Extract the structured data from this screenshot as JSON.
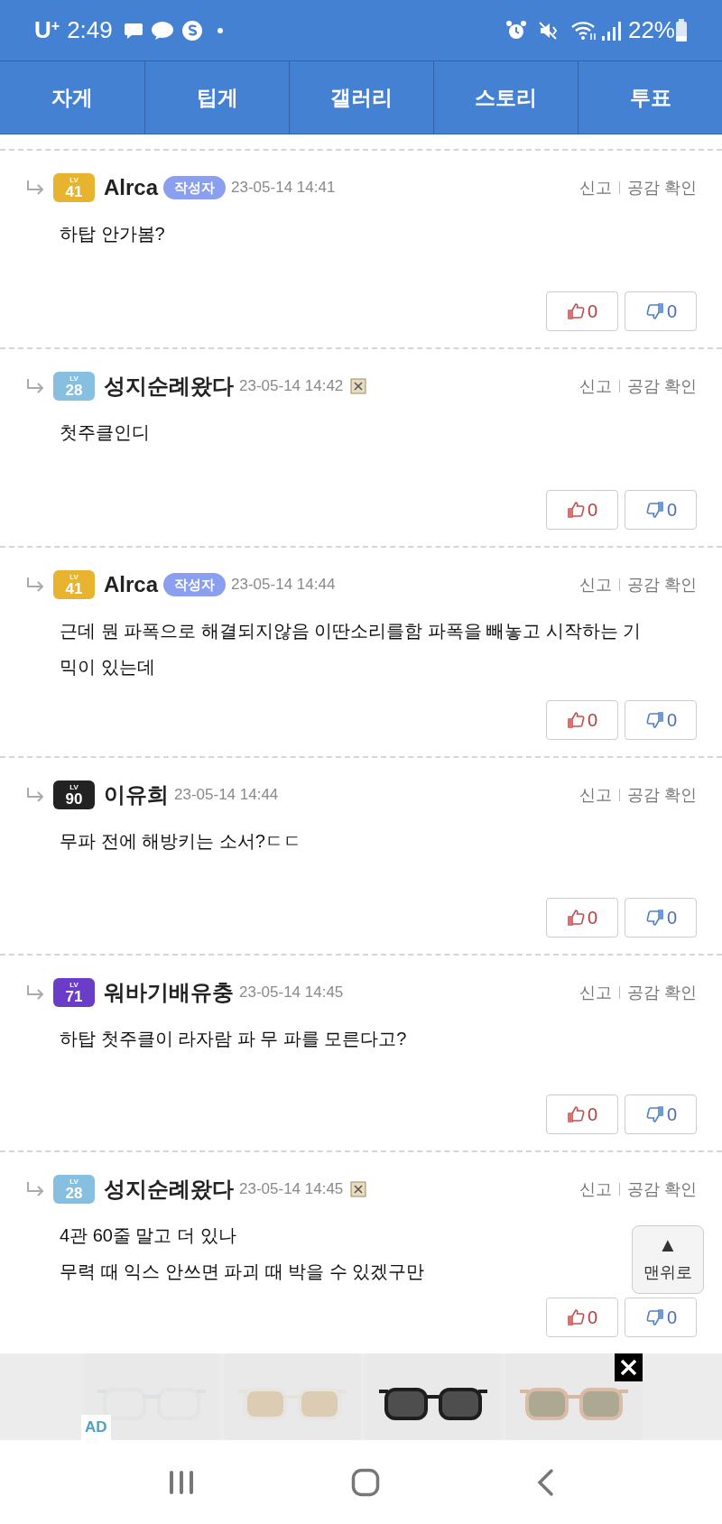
{
  "status_bar": {
    "carrier": "U",
    "carrier_mark": "+",
    "time": "2:49",
    "battery": "22%"
  },
  "tabs": [
    {
      "label": "자게",
      "selected": false
    },
    {
      "label": "팁게",
      "selected": false
    },
    {
      "label": "갤러리",
      "selected": false
    },
    {
      "label": "스토리",
      "selected": false
    },
    {
      "label": "투표",
      "selected": false
    }
  ],
  "comments": [
    {
      "level_prefix": "LV",
      "level": "41",
      "color": "#e8b430",
      "author": "Alrca",
      "author_tag": "작성자",
      "date": "23-05-14 14:41",
      "delete_mark": false,
      "report": "신고",
      "empathy": "공감 확인",
      "lines": [
        "하탑 안가봄?"
      ],
      "up": "0",
      "down": "0"
    },
    {
      "level_prefix": "LV",
      "level": "28",
      "color": "#86bfe0",
      "author": "성지순례왔다",
      "date": "23-05-14 14:42",
      "delete_mark": true,
      "report": "신고",
      "empathy": "공감 확인",
      "lines": [
        "첫주클인디"
      ],
      "up": "0",
      "down": "0"
    },
    {
      "level_prefix": "LV",
      "level": "41",
      "color": "#e8b430",
      "author": "Alrca",
      "author_tag": "작성자",
      "date": "23-05-14 14:44",
      "delete_mark": false,
      "report": "신고",
      "empathy": "공감 확인",
      "lines": [
        "근데 뭔 파폭으로 해결되지않음 이딴소리를함 파폭을 빼놓고 시작하는 기믹이 있는데"
      ],
      "up": "0",
      "down": "0"
    },
    {
      "level_prefix": "LV",
      "level": "90",
      "color": "#222222",
      "author": "이유희",
      "date": "23-05-14 14:44",
      "delete_mark": false,
      "report": "신고",
      "empathy": "공감 확인",
      "lines": [
        "무파 전에 해방키는 소서?ㄷㄷ"
      ],
      "up": "0",
      "down": "0"
    },
    {
      "level_prefix": "LV",
      "level": "71",
      "color": "#6a3cc8",
      "author": "워바기배유충",
      "date": "23-05-14 14:45",
      "delete_mark": false,
      "report": "신고",
      "empathy": "공감 확인",
      "lines": [
        "하탑 첫주클이 라자람 파 무 파를 모른다고?"
      ],
      "up": "0",
      "down": "0"
    },
    {
      "level_prefix": "LV",
      "level": "28",
      "color": "#86bfe0",
      "author": "성지순례왔다",
      "date": "23-05-14 14:45",
      "delete_mark": true,
      "report": "신고",
      "empathy": "공감 확인",
      "lines": [
        "4관 60줄 말고 더 있나",
        "무력 때 익스 안쓰면 파괴 때 박을 수 있겠구만"
      ],
      "up": "0",
      "down": "0"
    }
  ],
  "scroll_top": {
    "arrow": "▲",
    "label": "맨위로"
  },
  "ad": {
    "label": "AD",
    "products": [
      {
        "kind": "clear"
      },
      {
        "kind": "clear-gold"
      },
      {
        "kind": "dark"
      },
      {
        "kind": "tinted"
      }
    ]
  }
}
